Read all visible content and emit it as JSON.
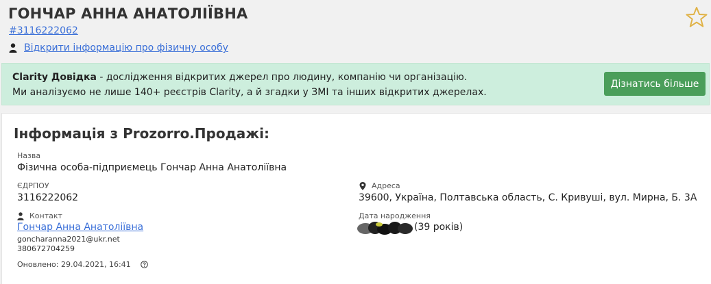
{
  "header": {
    "title": "ГОНЧАР АННА АНАТОЛІЇВНА",
    "id_link": "#3116222062",
    "person_link": "Відкрити інформацію про фізичну особу"
  },
  "banner": {
    "brand": "Clarity Довідка",
    "line1_rest": " - дослідження відкритих джерел про людину, компанію чи організацію.",
    "line2": "Ми аналізуємо не лише 140+ реєстрів Clarity, а й згадки у ЗМІ та інших відкритих джерелах.",
    "button": "Дізнатись більше",
    "colors": {
      "background": "#cdeedd",
      "button": "#4a9e5a"
    }
  },
  "info": {
    "title": "Інформація з Prozorro.Продажі:",
    "name_label": "Назва",
    "name_value": "Фізична особа-підприємець Гончар Анна Анатоліївна",
    "edrpou_label": "ЄДРПОУ",
    "edrpou_value": "3116222062",
    "address_label": "Адреса",
    "address_value": "39600, Україна, Полтавська область, С. Кривуші, вул. Мирна, Б. 3А",
    "contact_label": "Контакт",
    "contact_name": "Гончар Анна Анатоліївна",
    "contact_email": "goncharanna2021@ukr.net",
    "contact_phone": "380672704259",
    "birth_label": "Дата народження",
    "birth_age": "(39 років)",
    "updated": "Оновлено: 29.04.2021, 16:41"
  },
  "icons": {
    "star": "star-icon",
    "person": "user-icon",
    "location": "map-marker-icon",
    "help": "question-circle-icon"
  }
}
